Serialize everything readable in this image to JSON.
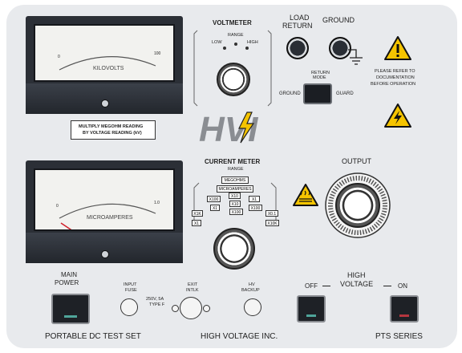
{
  "voltmeter": {
    "title": "VOLTMETER",
    "range_label": "RANGE",
    "low": "LOW",
    "high": "HIGH",
    "unit": "KILOVOLTS",
    "scale_min": "0",
    "scale_max": "100"
  },
  "multiply_note": {
    "line1": "MULTIPLY MEGOHM READING",
    "line2": "BY VOLTAGE READING (kV)"
  },
  "load_return": {
    "line1": "LOAD",
    "line2": "RETURN"
  },
  "ground": "GROUND",
  "warning": {
    "line1": "PLEASE REFER TO",
    "line2": "DOCUMENTATION",
    "line3": "BEFORE OPERATION"
  },
  "return_mode": {
    "label_line1": "RETURN",
    "label_line2": "MODE",
    "left": "GROUND",
    "right": "GUARD"
  },
  "logo": "HVI",
  "current_meter": {
    "title": "CURRENT METER",
    "range_label": "RANGE",
    "megohms": "MEGOHMS",
    "microamperes": "MICROAMPERES",
    "unit": "MICROAMPERES",
    "scale_min": "0",
    "scale_max": "1.0",
    "multipliers": [
      "X100",
      "X10",
      "X1",
      "X1K",
      "X1",
      "X10",
      "X100",
      "X1",
      "X100",
      "X0.1",
      "X10K"
    ]
  },
  "output": "OUTPUT",
  "main_power": {
    "line1": "MAIN",
    "line2": "POWER"
  },
  "input_fuse": {
    "line1": "INPUT",
    "line2": "FUSE",
    "rating1": "250V, 5A",
    "rating2": "TYPE F"
  },
  "exit_intlk": {
    "line1": "EXIT",
    "line2": "INTLK"
  },
  "hv_backup": {
    "line1": "HV",
    "line2": "BACKUP"
  },
  "high_voltage": {
    "line1": "HIGH",
    "line2": "VOLTAGE",
    "off": "OFF",
    "on": "ON"
  },
  "footer": {
    "left": "PORTABLE DC TEST SET",
    "center": "HIGH VOLTAGE INC.",
    "right": "PTS SERIES"
  },
  "colors": {
    "panel": "#e8eaed",
    "needle": "#d11f2a",
    "accent_yellow": "#f5c400",
    "logo_gray": "#8a8d92",
    "led_green": "#4fa59a",
    "led_red": "#b4363e"
  }
}
